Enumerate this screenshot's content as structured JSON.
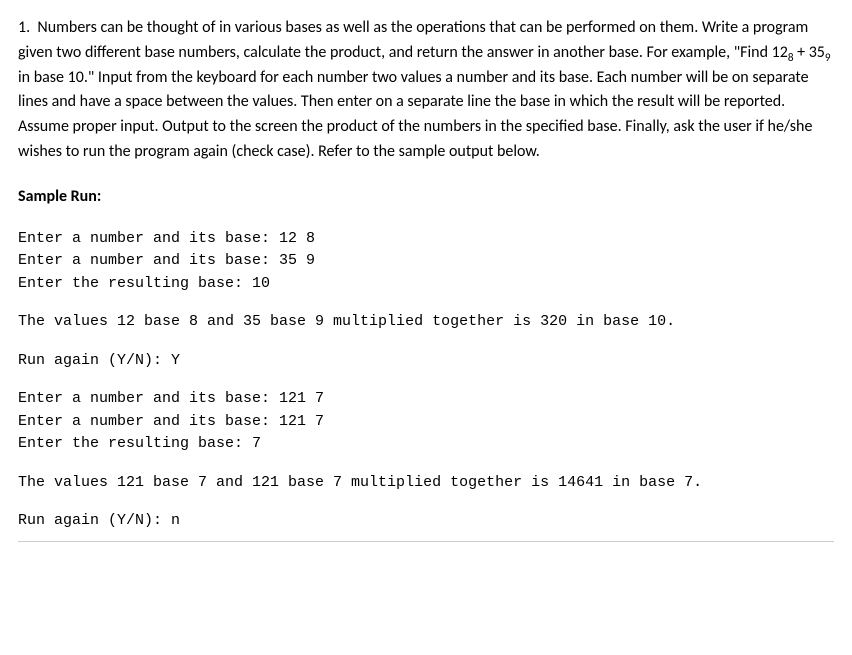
{
  "question": {
    "number": "1.",
    "text_part1": "Numbers can be thought of in various bases as well as the operations that can be performed on them. Write a program given two different base numbers, calculate the product, and return the answer in another base. For example, \"Find 12",
    "sub1": "8",
    "text_part2": " + 35",
    "sub2": "9",
    "text_part3": " in base 10.\"  Input from the keyboard for each number two values a number and its base.  Each number will be on separate lines and have a space between the values.  Then enter on a separate line the base in which the result will be reported. Assume proper input.  Output to the screen the product of the numbers in the specified base.  Finally, ask the user if he/she wishes to run the program again (check case). Refer to the sample output below."
  },
  "sample_heading": "Sample Run:",
  "runs": [
    {
      "line1": "Enter a number and its base: 12 8",
      "line2": "Enter a number and its base: 35 9",
      "line3": "Enter the resulting base: 10",
      "result": "The values 12 base 8 and 35 base 9 multiplied together is 320 in base 10.",
      "again": "Run again (Y/N): Y"
    },
    {
      "line1": "Enter a number and its base: 121 7",
      "line2": "Enter a number and its base: 121 7",
      "line3": "Enter the resulting base: 7",
      "result": "The values 121 base 7 and 121 base 7 multiplied together is 14641 in base 7.",
      "again": "Run again (Y/N): n"
    }
  ]
}
